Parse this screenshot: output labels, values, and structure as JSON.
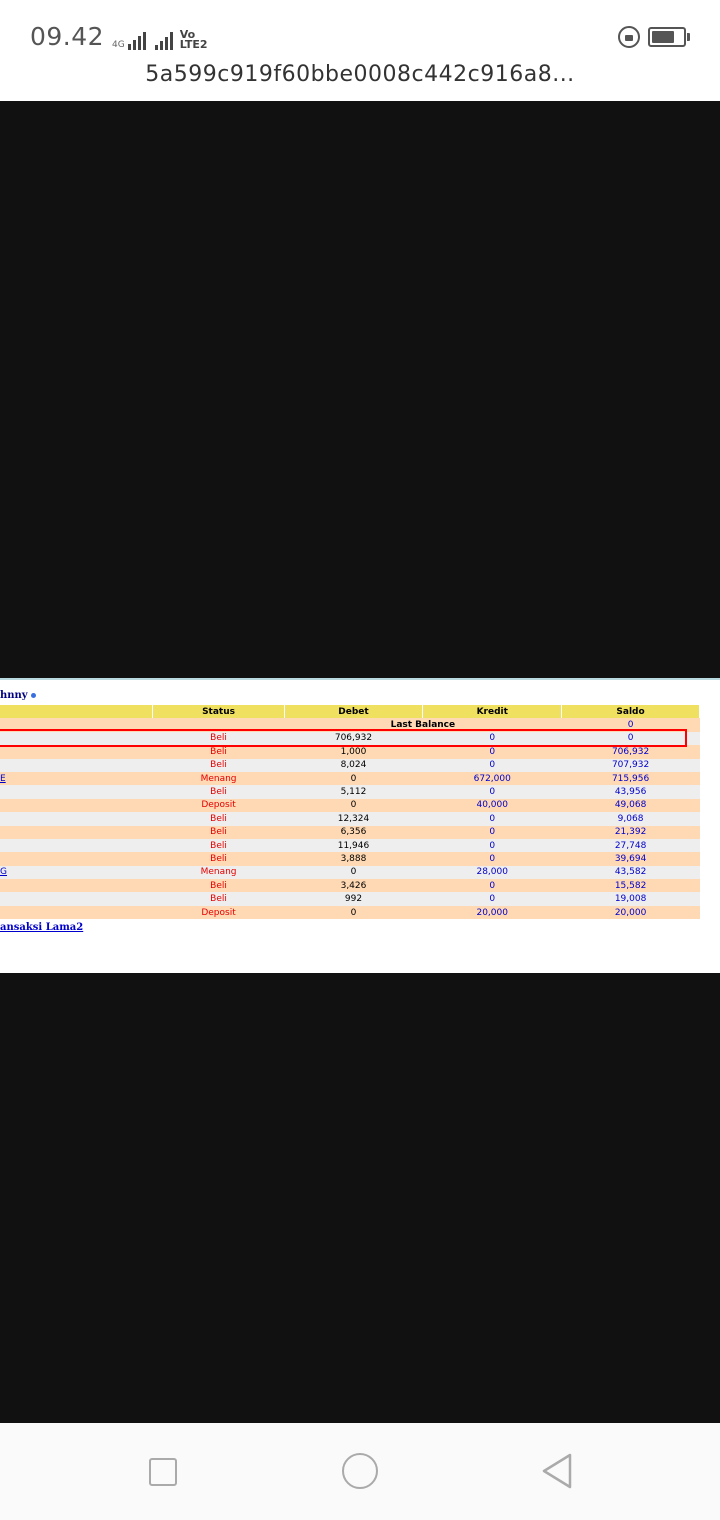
{
  "status_bar": {
    "time": "09.42",
    "network_small": "4G",
    "volte": "Vo\nLTE2",
    "icons": [
      "signal-icon",
      "lock-rotation-icon",
      "battery-icon"
    ]
  },
  "page": {
    "title": "5a599c919f60bbe0008c442c916a8..."
  },
  "report": {
    "user": "hnny",
    "columns": [
      "",
      "Status",
      "Debet",
      "Kredit",
      "Saldo"
    ],
    "last_balance_label": "Last Balance",
    "last_balance_value": "0",
    "rows": [
      {
        "ref": "",
        "status": "Beli",
        "debet": "706,932",
        "kredit": "0",
        "saldo": "0"
      },
      {
        "ref": "",
        "status": "Beli",
        "debet": "1,000",
        "kredit": "0",
        "saldo": "706,932"
      },
      {
        "ref": "",
        "status": "Beli",
        "debet": "8,024",
        "kredit": "0",
        "saldo": "707,932"
      },
      {
        "ref": "E",
        "status": "Menang",
        "debet": "0",
        "kredit": "672,000",
        "saldo": "715,956"
      },
      {
        "ref": "",
        "status": "Beli",
        "debet": "5,112",
        "kredit": "0",
        "saldo": "43,956"
      },
      {
        "ref": "",
        "status": "Deposit",
        "debet": "0",
        "kredit": "40,000",
        "saldo": "49,068"
      },
      {
        "ref": "",
        "status": "Beli",
        "debet": "12,324",
        "kredit": "0",
        "saldo": "9,068"
      },
      {
        "ref": "",
        "status": "Beli",
        "debet": "6,356",
        "kredit": "0",
        "saldo": "21,392"
      },
      {
        "ref": "",
        "status": "Beli",
        "debet": "11,946",
        "kredit": "0",
        "saldo": "27,748"
      },
      {
        "ref": "",
        "status": "Beli",
        "debet": "3,888",
        "kredit": "0",
        "saldo": "39,694"
      },
      {
        "ref": "G",
        "status": "Menang",
        "debet": "0",
        "kredit": "28,000",
        "saldo": "43,582"
      },
      {
        "ref": "",
        "status": "Beli",
        "debet": "3,426",
        "kredit": "0",
        "saldo": "15,582"
      },
      {
        "ref": "",
        "status": "Beli",
        "debet": "992",
        "kredit": "0",
        "saldo": "19,008"
      },
      {
        "ref": "",
        "status": "Deposit",
        "debet": "0",
        "kredit": "20,000",
        "saldo": "20,000"
      }
    ],
    "old_transactions_link": "ansaksi Lama2"
  },
  "colors": {
    "header_bg": "#f0e060",
    "row_orange": "#ffd9b3",
    "row_gray": "#eeeeee",
    "status_red": "#e60000",
    "value_blue": "#0000cc",
    "highlight": "#ff0000"
  },
  "nav_bar": {
    "icons": [
      "recent-apps-icon",
      "home-icon",
      "back-icon"
    ]
  }
}
